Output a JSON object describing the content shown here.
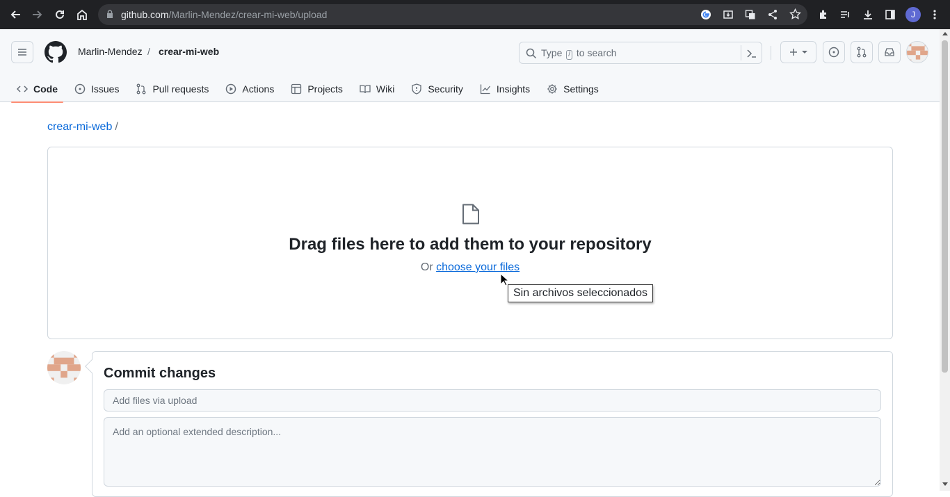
{
  "browser": {
    "url_host": "github.com",
    "url_path": "/Marlin-Mendez/crear-mi-web/upload",
    "profile_initial": "J"
  },
  "header": {
    "owner": "Marlin-Mendez",
    "separator": "/",
    "repo": "crear-mi-web",
    "search_prefix": "Type",
    "search_key": "/",
    "search_suffix": "to search"
  },
  "tabs": [
    {
      "label": "Code",
      "icon": "code-icon"
    },
    {
      "label": "Issues",
      "icon": "issue-icon"
    },
    {
      "label": "Pull requests",
      "icon": "pull-request-icon"
    },
    {
      "label": "Actions",
      "icon": "play-icon"
    },
    {
      "label": "Projects",
      "icon": "table-icon"
    },
    {
      "label": "Wiki",
      "icon": "book-icon"
    },
    {
      "label": "Security",
      "icon": "shield-icon"
    },
    {
      "label": "Insights",
      "icon": "graph-icon"
    },
    {
      "label": "Settings",
      "icon": "gear-icon"
    }
  ],
  "main": {
    "breadcrumb_repo": "crear-mi-web",
    "breadcrumb_sep": "/",
    "drop_title": "Drag files here to add them to your repository",
    "choose_prefix": "Or",
    "choose_link": "choose your files",
    "tooltip": "Sin archivos seleccionados"
  },
  "commit": {
    "title": "Commit changes",
    "summary_placeholder": "Add files via upload",
    "description_placeholder": "Add an optional extended description..."
  },
  "colors": {
    "link": "#0969da",
    "active_tab_underline": "#fd8c73",
    "chrome_bg": "#202124"
  }
}
